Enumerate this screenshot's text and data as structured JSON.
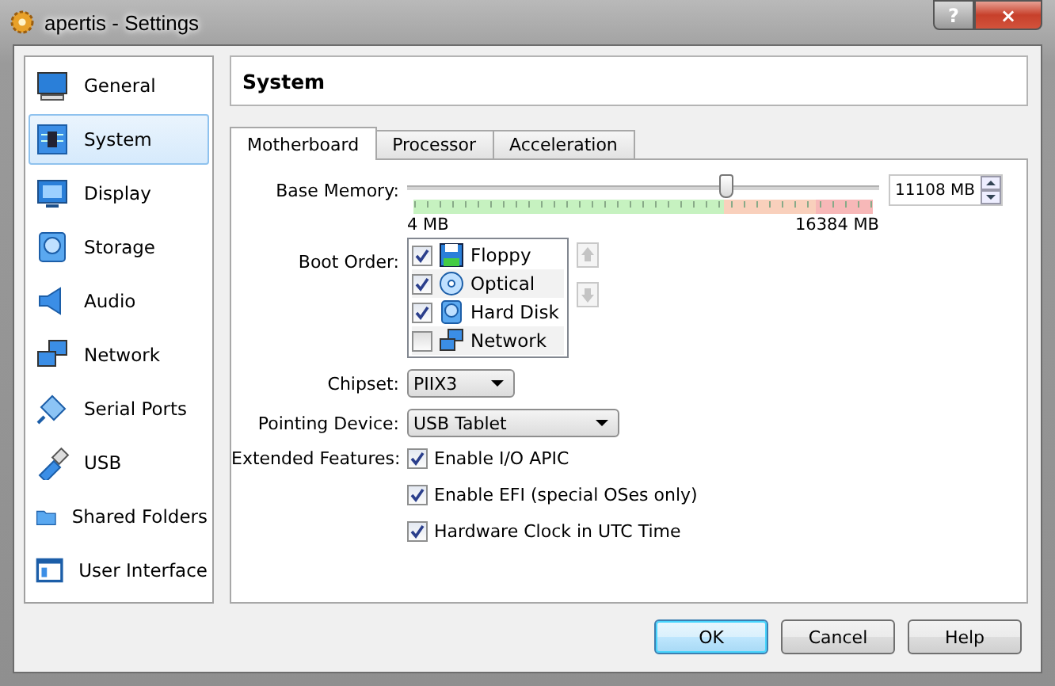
{
  "window": {
    "title": "apertis - Settings",
    "controls": [
      {
        "kind": "help",
        "label": "?"
      },
      {
        "kind": "close",
        "label": "×"
      }
    ]
  },
  "sidebar": {
    "items": [
      {
        "label": "General",
        "selected": false
      },
      {
        "label": "System",
        "selected": true
      },
      {
        "label": "Display",
        "selected": false
      },
      {
        "label": "Storage",
        "selected": false
      },
      {
        "label": "Audio",
        "selected": false
      },
      {
        "label": "Network",
        "selected": false
      },
      {
        "label": "Serial Ports",
        "selected": false
      },
      {
        "label": "USB",
        "selected": false
      },
      {
        "label": "Shared Folders",
        "selected": false
      },
      {
        "label": "User Interface",
        "selected": false
      }
    ]
  },
  "page_title": "System",
  "tabs": [
    {
      "label": "Motherboard",
      "selected": true
    },
    {
      "label": "Processor",
      "selected": false
    },
    {
      "label": "Acceleration",
      "selected": false
    }
  ],
  "base_memory": {
    "label": "Base Memory:",
    "level": 0.678,
    "value": "11108 MB",
    "min_label": "4 MB",
    "max_label": "16384 MB"
  },
  "boot_order": {
    "label": "Boot Order:",
    "items": [
      {
        "label": "Floppy",
        "checked": true
      },
      {
        "label": "Optical",
        "checked": true
      },
      {
        "label": "Hard Disk",
        "checked": true
      },
      {
        "label": "Network",
        "checked": false
      }
    ]
  },
  "chipset": {
    "label": "Chipset:",
    "value": "PIIX3"
  },
  "pointing_device": {
    "label": "Pointing Device:",
    "value": "USB Tablet"
  },
  "extended_features": {
    "label": "Extended Features:",
    "options": [
      {
        "label": "Enable I/O APIC",
        "checked": true
      },
      {
        "label": "Enable EFI (special OSes only)",
        "checked": true
      },
      {
        "label": "Hardware Clock in UTC Time",
        "checked": true
      }
    ]
  },
  "buttons": [
    {
      "label": "OK",
      "default": true
    },
    {
      "label": "Cancel",
      "default": false
    },
    {
      "label": "Help",
      "default": false
    }
  ]
}
